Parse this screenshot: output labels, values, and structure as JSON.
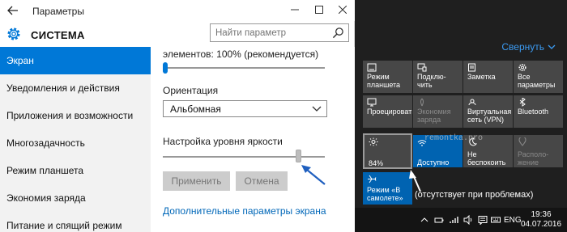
{
  "settings_window": {
    "title": "Параметры",
    "section_title": "СИСТЕМА",
    "search": {
      "placeholder": "Найти параметр"
    },
    "nav": [
      {
        "label": "Экран",
        "active": true
      },
      {
        "label": "Уведомления и действия"
      },
      {
        "label": "Приложения и возможности"
      },
      {
        "label": "Многозадачность"
      },
      {
        "label": "Режим планшета"
      },
      {
        "label": "Экономия заряда"
      },
      {
        "label": "Питание и спящий режим"
      }
    ],
    "content": {
      "scale_label": "элементов: 100% (рекомендуется)",
      "orientation_label": "Ориентация",
      "orientation_value": "Альбомная",
      "brightness_label": "Настройка уровня яркости",
      "brightness_level": 0.84,
      "apply_label": "Применить",
      "cancel_label": "Отмена",
      "advanced_link": "Дополнительные параметры экрана"
    }
  },
  "action_center": {
    "collapse_label": "Свернуть",
    "tiles": [
      {
        "label": "Режим планшета",
        "icon": "tablet-mode-icon",
        "state": "off"
      },
      {
        "label": "Подклю-чить",
        "icon": "connect-icon",
        "state": "off"
      },
      {
        "label": "Заметка",
        "icon": "note-icon",
        "state": "off"
      },
      {
        "label": "Все параметры",
        "icon": "settings-icon",
        "state": "off"
      },
      {
        "label": "Проецировать",
        "icon": "project-icon",
        "state": "off"
      },
      {
        "label": "Экономия заряда",
        "icon": "battery-saver-icon",
        "state": "disabled"
      },
      {
        "label": "Виртуальная сеть (VPN)",
        "icon": "vpn-icon",
        "state": "off"
      },
      {
        "label": "Bluetooth",
        "icon": "bluetooth-icon",
        "state": "off"
      },
      {
        "label": "84%",
        "icon": "brightness-icon",
        "state": "selected"
      },
      {
        "label": "Доступно",
        "icon": "wifi-icon",
        "state": "on"
      },
      {
        "label": "Не беспокоить",
        "icon": "moon-icon",
        "state": "off"
      },
      {
        "label": "Располо-жение",
        "icon": "location-icon",
        "state": "disabled"
      },
      {
        "label": "Режим «В самолете»",
        "icon": "airplane-icon",
        "state": "on"
      }
    ],
    "annotation": "(отсутствует при проблемах)",
    "watermark": "remontka.pro",
    "taskbar": {
      "language": "ENG",
      "time": "19:36",
      "date": "04.07.2016"
    }
  },
  "colors": {
    "accent": "#0078d7",
    "tile_on": "#0063b1",
    "tile_off": "#474747",
    "link": "#0067b8",
    "collapse": "#3b9bf3"
  }
}
